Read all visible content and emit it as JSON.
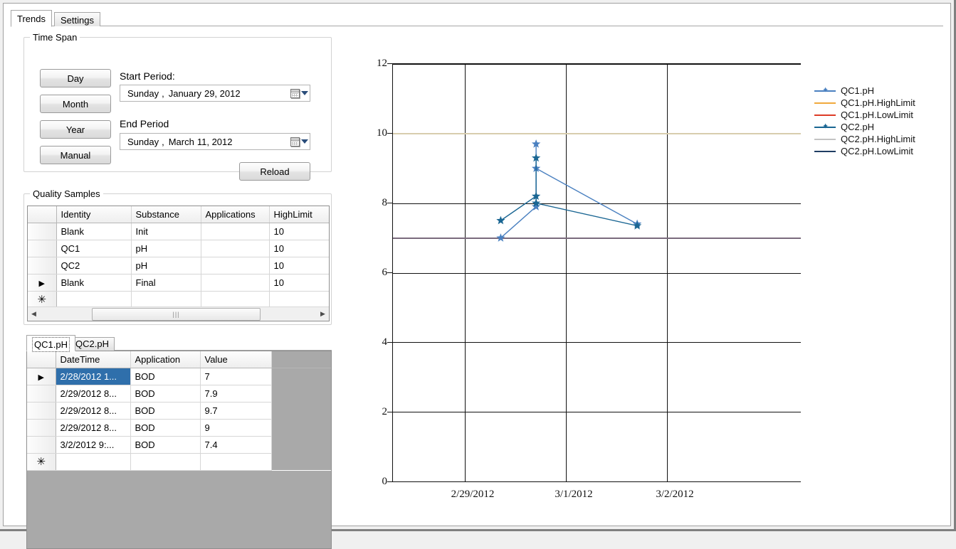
{
  "window": {
    "background": "#f0f0f0"
  },
  "tabs": [
    {
      "label": "Trends",
      "selected": true
    },
    {
      "label": "Settings",
      "selected": false
    }
  ],
  "time_span": {
    "title": "Time Span",
    "range_buttons": [
      {
        "label": "Day"
      },
      {
        "label": "Month"
      },
      {
        "label": "Year"
      },
      {
        "label": "Manual"
      }
    ],
    "start_label": "Start Period:",
    "start_value": {
      "day_of_week": "Sunday",
      "comma": ",",
      "month": "January",
      "day_year": "29, 2012"
    },
    "end_label": "End Period",
    "end_value": {
      "day_of_week": "Sunday",
      "comma": ",",
      "month": "March",
      "day_year": "11, 2012"
    },
    "reload_label": "Reload"
  },
  "quality_samples": {
    "title": "Quality Samples",
    "columns": [
      "Identity",
      "Substance",
      "Applications",
      "HighLimit"
    ],
    "rows": [
      {
        "marker": "",
        "Identity": "Blank",
        "Substance": "Init",
        "Applications": "",
        "HighLimit": "10"
      },
      {
        "marker": "",
        "Identity": "QC1",
        "Substance": "pH",
        "Applications": "",
        "HighLimit": "10"
      },
      {
        "marker": "",
        "Identity": "QC2",
        "Substance": "pH",
        "Applications": "",
        "HighLimit": "10"
      },
      {
        "marker": "▶",
        "Identity": "Blank",
        "Substance": "Final",
        "Applications": "",
        "HighLimit": "10"
      },
      {
        "marker": "✳",
        "Identity": "",
        "Substance": "",
        "Applications": "",
        "HighLimit": ""
      }
    ],
    "scrollbar": {
      "left_arrow": "◀",
      "right_arrow": "▶",
      "thumb_grip": "|||"
    }
  },
  "series_tabs": [
    {
      "label": "QC1.pH",
      "selected": true
    },
    {
      "label": "QC2.pH",
      "selected": false
    }
  ],
  "series_grid": {
    "columns": [
      "DateTime",
      "Application",
      "Value"
    ],
    "rows": [
      {
        "marker": "▶",
        "DateTime": "2/28/2012 1...",
        "Application": "BOD",
        "Value": "7",
        "selected": true
      },
      {
        "marker": "",
        "DateTime": "2/29/2012 8...",
        "Application": "BOD",
        "Value": "7.9",
        "selected": false
      },
      {
        "marker": "",
        "DateTime": "2/29/2012 8...",
        "Application": "BOD",
        "Value": "9.7",
        "selected": false
      },
      {
        "marker": "",
        "DateTime": "2/29/2012 8...",
        "Application": "BOD",
        "Value": "9",
        "selected": false
      },
      {
        "marker": "",
        "DateTime": "3/2/2012 9:...",
        "Application": "BOD",
        "Value": "7.4",
        "selected": false
      },
      {
        "marker": "✳",
        "DateTime": "",
        "Application": "",
        "Value": "",
        "selected": false
      }
    ]
  },
  "chart_data": {
    "type": "line",
    "title": "",
    "xlabel": "",
    "ylabel": "",
    "ylim": [
      0,
      12
    ],
    "yticks": [
      0,
      2,
      4,
      6,
      8,
      10,
      12
    ],
    "xticks": [
      "2/29/2012",
      "3/1/2012",
      "3/2/2012"
    ],
    "grid": true,
    "legend_position": "right",
    "series": [
      {
        "name": "QC1.pH",
        "color": "#4a80c0",
        "marker": "star",
        "x": [
          0.355,
          0.705,
          0.705,
          0.705,
          1.705
        ],
        "y": [
          7,
          7.9,
          9.7,
          9,
          7.4
        ],
        "labels": [
          "2/28/2012 1...",
          "2/29/2012 8...",
          "2/29/2012 8...",
          "2/29/2012 8...",
          "3/2/2012 9:..."
        ]
      },
      {
        "name": "QC1.pH.HighLimit",
        "color": "#f0a93c",
        "marker": "none",
        "constant": 10
      },
      {
        "name": "QC1.pH.LowLimit",
        "color": "#dd3b26",
        "marker": "none",
        "constant": 7
      },
      {
        "name": "QC2.pH",
        "color": "#1a6693",
        "marker": "star",
        "x": [
          0.355,
          0.705,
          0.705,
          0.705,
          1.705
        ],
        "y": [
          7.5,
          8.2,
          9.3,
          8.0,
          7.35
        ],
        "labels": [
          "",
          "",
          "",
          "",
          ""
        ]
      },
      {
        "name": "QC2.pH.HighLimit",
        "color": "#c3c3c3",
        "marker": "none",
        "constant": 10
      },
      {
        "name": "QC2.pH.LowLimit",
        "color": "#1f3d63",
        "marker": "none",
        "constant": 7
      }
    ],
    "limit_lines": [
      {
        "value": 10,
        "color": "#d8cdae"
      },
      {
        "value": 7,
        "color": "#7a6a7d"
      }
    ]
  }
}
